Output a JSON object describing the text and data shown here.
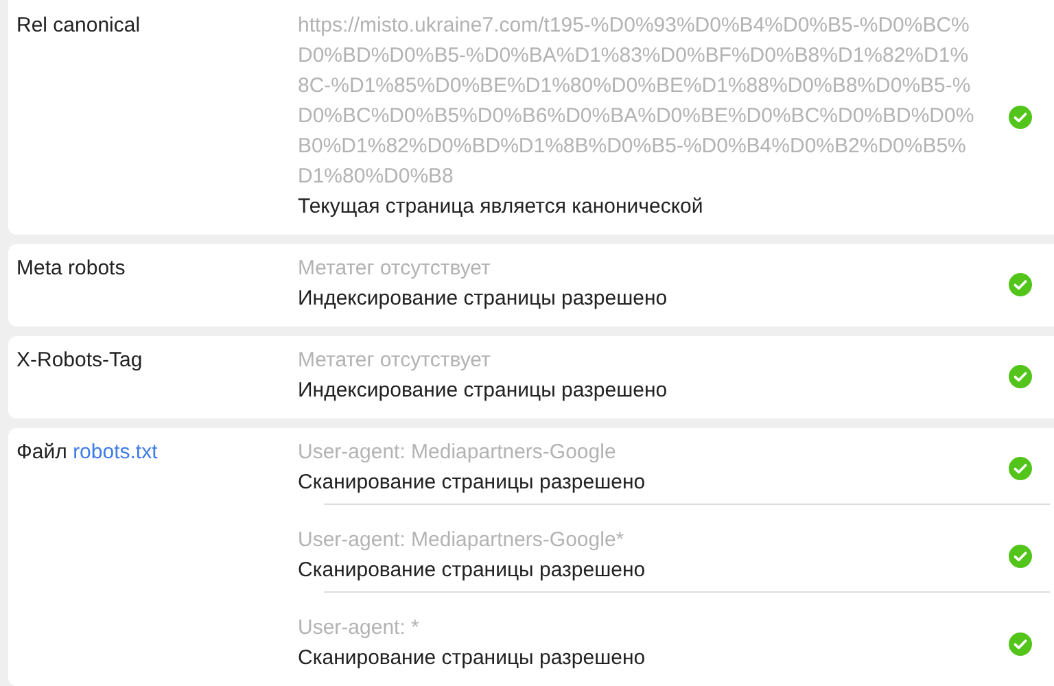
{
  "rows": [
    {
      "label": "Rel canonical",
      "entries": [
        {
          "detail": "https://misto.ukraine7.com/t195-%D0%93%D0%B4%D0%B5-%D0%BC%D0%BD%D0%B5-%D0%BA%D1%83%D0%BF%D0%B8%D1%82%D1%8C-%D1%85%D0%BE%D1%80%D0%BE%D1%88%D0%B8%D0%B5-%D0%BC%D0%B5%D0%B6%D0%BA%D0%BE%D0%BC%D0%BD%D0%B0%D1%82%D0%BD%D1%8B%D0%B5-%D0%B4%D0%B2%D0%B5%D1%80%D0%B8",
          "result": "Текущая страница является канонической",
          "passed": true
        }
      ]
    },
    {
      "label": "Meta robots",
      "entries": [
        {
          "detail": "Метатег отсутствует",
          "result": "Индексирование страницы разрешено",
          "passed": true
        }
      ]
    },
    {
      "label": "X-Robots-Tag",
      "entries": [
        {
          "detail": "Метатег отсутствует",
          "result": "Индексирование страницы разрешено",
          "passed": true
        }
      ]
    },
    {
      "label": "Файл",
      "link": "robots.txt",
      "entries": [
        {
          "detail": "User-agent: Mediapartners-Google",
          "result": "Сканирование страницы разрешено",
          "passed": true
        },
        {
          "detail": "User-agent: Mediapartners-Google*",
          "result": "Сканирование страницы разрешено",
          "passed": true
        },
        {
          "detail": "User-agent: *",
          "result": "Сканирование страницы разрешено",
          "passed": true
        }
      ]
    }
  ]
}
